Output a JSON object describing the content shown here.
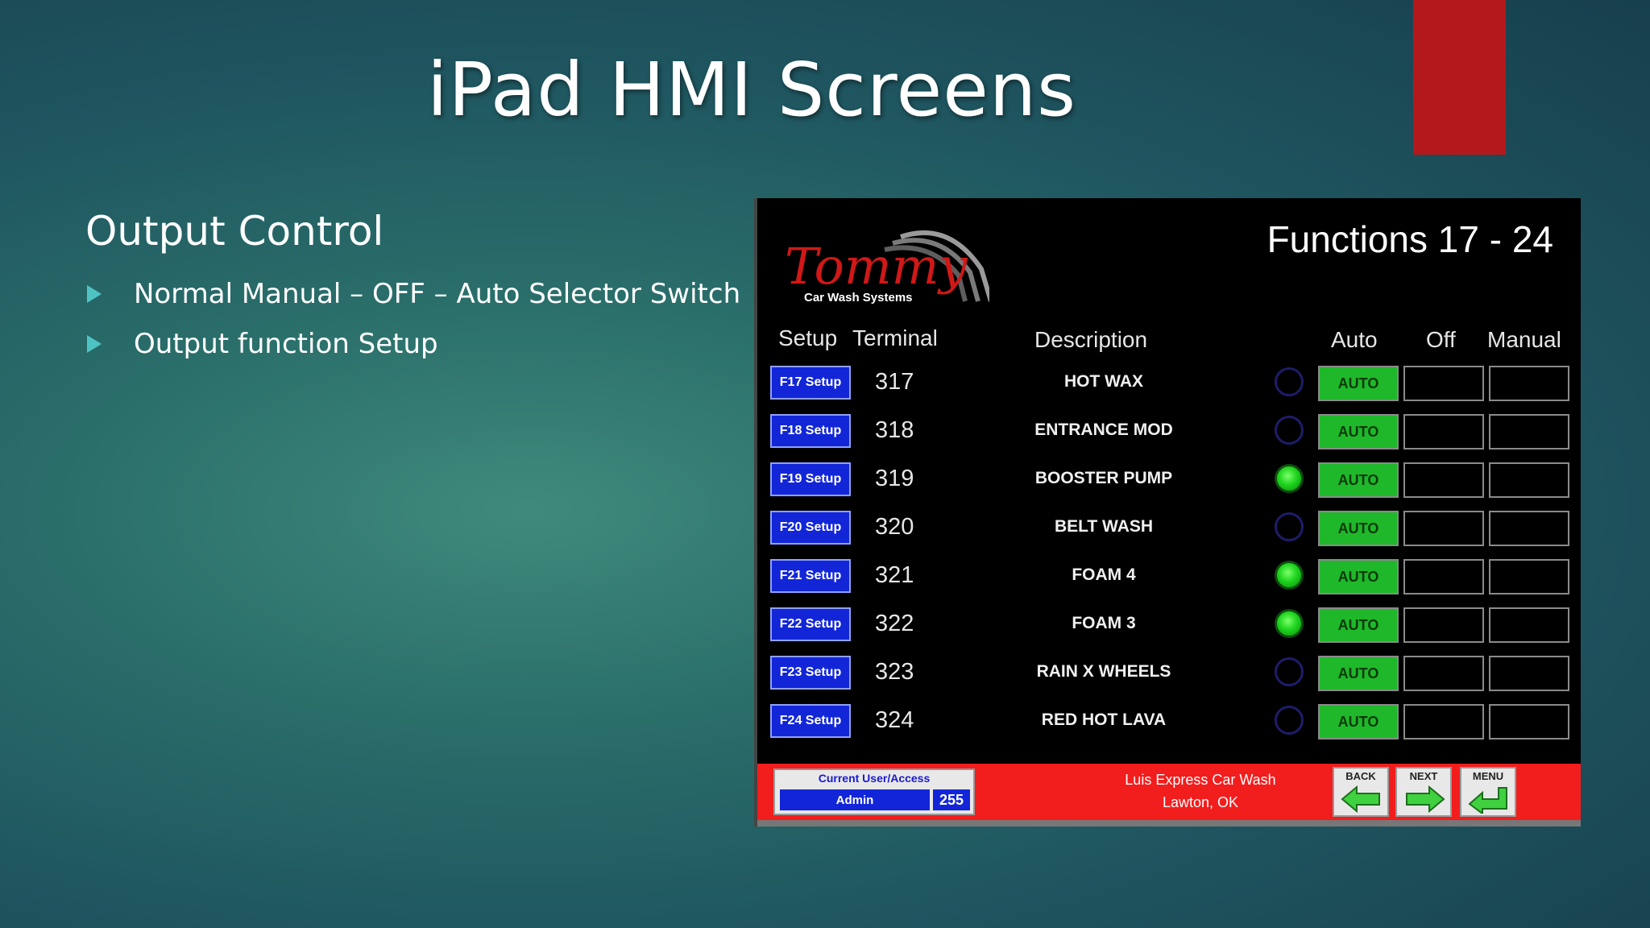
{
  "slide": {
    "title": "iPad HMI Screens",
    "section": "Output Control",
    "bullets": [
      "Normal Manual – OFF – Auto Selector Switch",
      "Output function Setup"
    ]
  },
  "hmi": {
    "logo_text": "Tommy",
    "logo_subtext": "Car Wash Systems",
    "title": "Functions 17 - 24",
    "columns": {
      "setup": "Setup",
      "terminal": "Terminal",
      "description": "Description",
      "auto": "Auto",
      "off": "Off",
      "manual": "Manual"
    },
    "rows": [
      {
        "setup": "F17 Setup",
        "terminal": "317",
        "description": "HOT WAX",
        "status_on": false,
        "mode": "AUTO"
      },
      {
        "setup": "F18 Setup",
        "terminal": "318",
        "description": "ENTRANCE MOD",
        "status_on": false,
        "mode": "AUTO"
      },
      {
        "setup": "F19 Setup",
        "terminal": "319",
        "description": "BOOSTER PUMP",
        "status_on": true,
        "mode": "AUTO"
      },
      {
        "setup": "F20 Setup",
        "terminal": "320",
        "description": "BELT WASH",
        "status_on": false,
        "mode": "AUTO"
      },
      {
        "setup": "F21 Setup",
        "terminal": "321",
        "description": "FOAM 4",
        "status_on": true,
        "mode": "AUTO"
      },
      {
        "setup": "F22 Setup",
        "terminal": "322",
        "description": "FOAM 3",
        "status_on": true,
        "mode": "AUTO"
      },
      {
        "setup": "F23 Setup",
        "terminal": "323",
        "description": "RAIN X WHEELS",
        "status_on": false,
        "mode": "AUTO"
      },
      {
        "setup": "F24 Setup",
        "terminal": "324",
        "description": "RED HOT LAVA",
        "status_on": false,
        "mode": "AUTO"
      }
    ],
    "footer": {
      "user_label": "Current User/Access",
      "user_name": "Admin",
      "access_level": "255",
      "site_name": "Luis Express Car Wash",
      "site_location": "Lawton, OK",
      "nav": {
        "back": "BACK",
        "next": "NEXT",
        "menu": "MENU"
      }
    }
  },
  "colors": {
    "accent_red": "#b3191c",
    "setup_blue": "#1226d8",
    "auto_green": "#1fb82a",
    "footer_red": "#f21d1d",
    "bullet_arrow": "#4fc3c3"
  }
}
